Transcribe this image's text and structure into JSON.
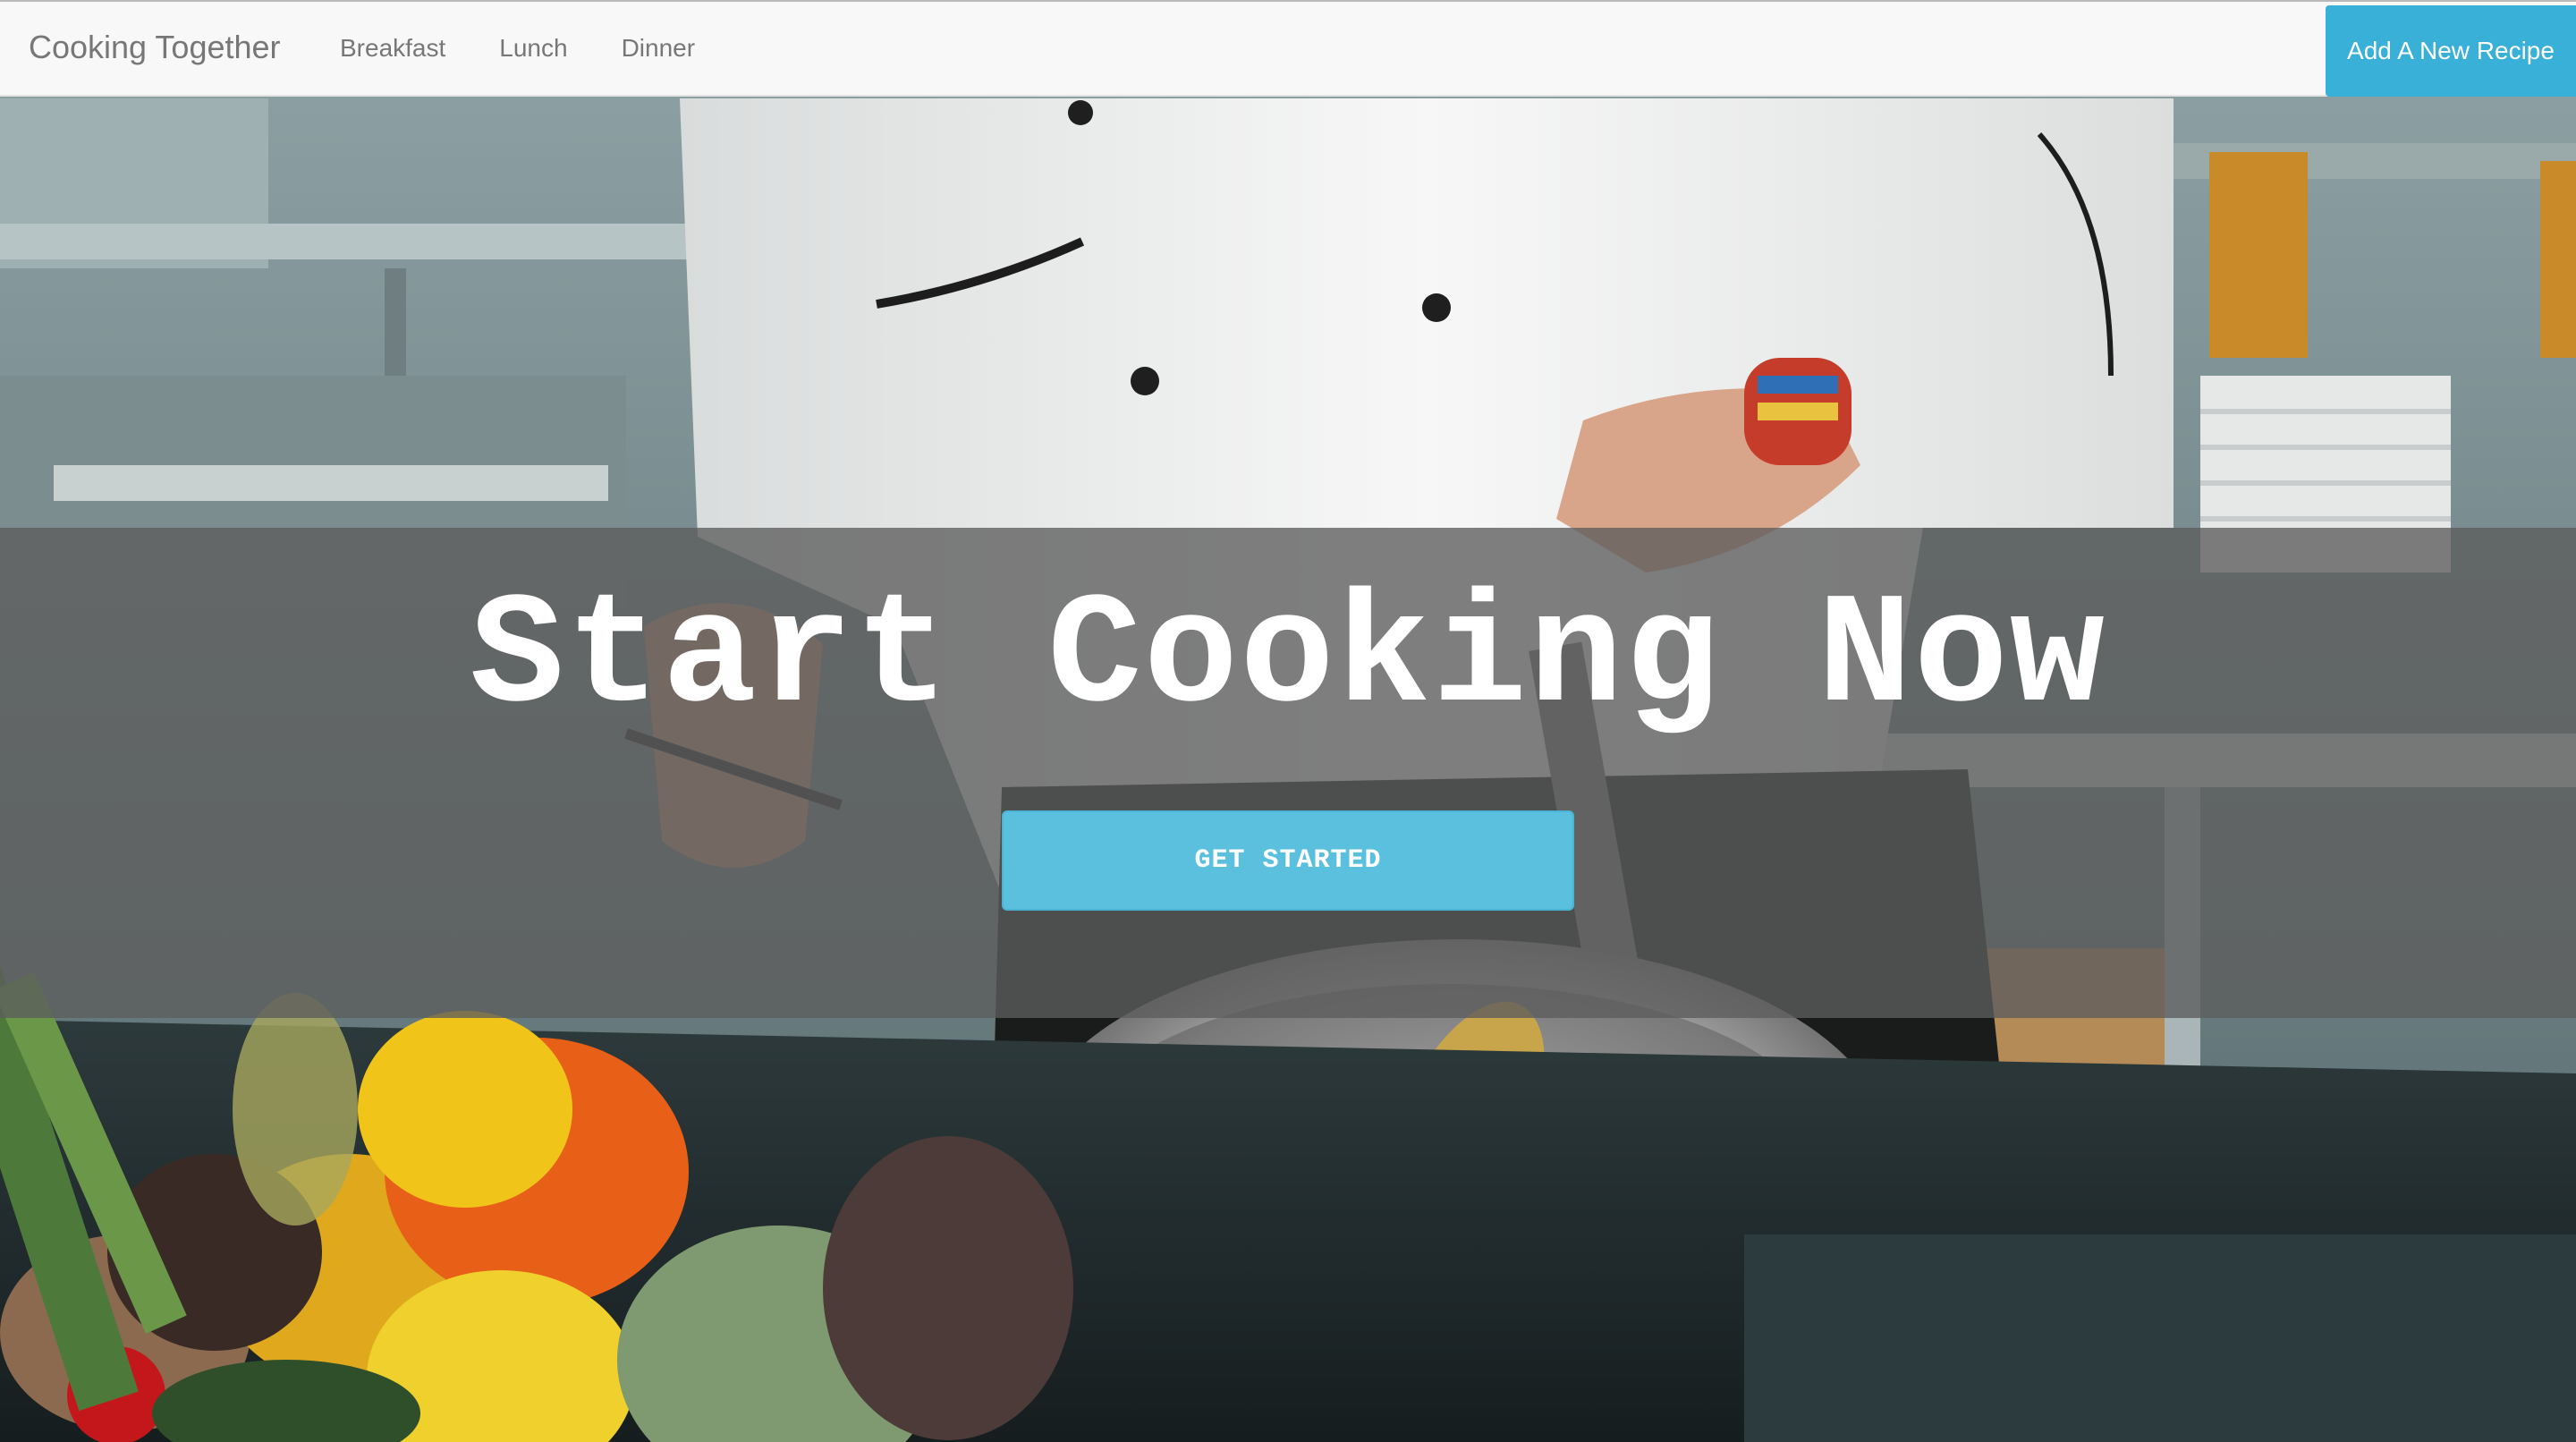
{
  "navbar": {
    "brand": "Cooking Together",
    "links": [
      "Breakfast",
      "Lunch",
      "Dinner"
    ],
    "cta_label": "Add A New Recipe"
  },
  "hero": {
    "title": "Start Cooking Now",
    "button_label": "GET STARTED",
    "background_image": "kitchen-chef-cooking-photo"
  },
  "colors": {
    "accent": "#5bc0de",
    "nav_cta": "#38b0d8",
    "overlay": "#5c5c5c"
  }
}
